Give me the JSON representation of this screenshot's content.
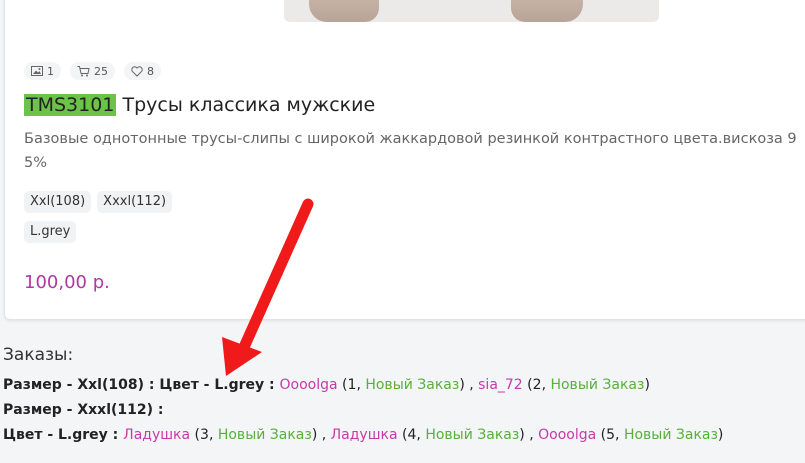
{
  "product": {
    "stats": [
      {
        "icon": "image-icon",
        "count": "1"
      },
      {
        "icon": "cart-icon",
        "count": "25"
      },
      {
        "icon": "heart-icon",
        "count": "8"
      }
    ],
    "sku": "TMS3101",
    "name": " Трусы классика мужские",
    "description_line1": "Базовые однотонные трусы-слипы с широкой жаккардовой резинкой контрастного цвета.вискоза 9",
    "description_line2": "5%",
    "sizes": [
      "Xxl(108)",
      "Xxxl(112)"
    ],
    "colors": [
      "L.grey"
    ],
    "price": "100,00 р."
  },
  "orders": {
    "heading": "Заказы:",
    "line1": {
      "label": "Размер - Xxl(108) : Цвет - L.grey",
      "sep": " : ",
      "entries": [
        {
          "user": "Oooolga",
          "num": "1",
          "status": "Новый Заказ"
        },
        {
          "user": "sia_72",
          "num": "2",
          "status": "Новый Заказ"
        }
      ]
    },
    "line2": {
      "label": "Размер - Xxxl(112) :"
    },
    "line3": {
      "label": "Цвет - L.grey",
      "sep": " : ",
      "entries": [
        {
          "user": "Ладушка",
          "num": "3",
          "status": "Новый Заказ"
        },
        {
          "user": "Ладушка",
          "num": "4",
          "status": "Новый Заказ"
        },
        {
          "user": "Oooolga",
          "num": "5",
          "status": "Новый Заказ"
        }
      ]
    }
  },
  "colors": {
    "sku_highlight": "#6dc34a",
    "price": "#b0399f",
    "user_link": "#c73aa8",
    "status_link": "#59b039",
    "arrow": "#f01a1a"
  }
}
